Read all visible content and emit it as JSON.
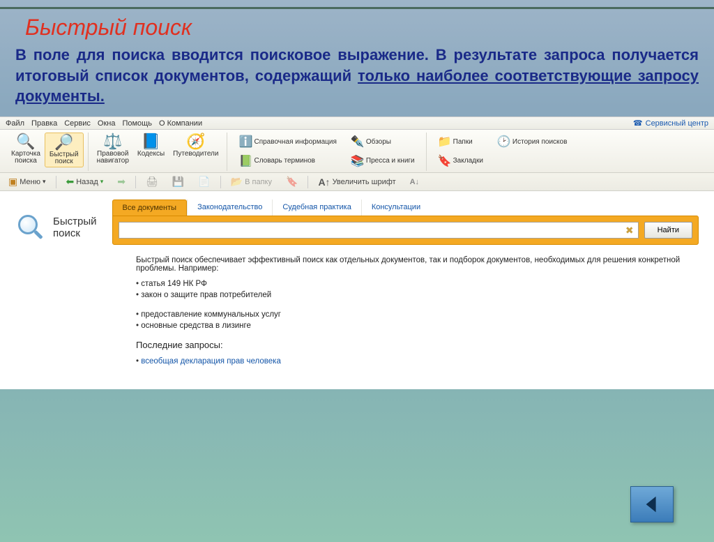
{
  "slide": {
    "title": "Быстрый поиск",
    "text_plain": "В поле для поиска вводится поисковое выражение. В результате запроса получается итоговый список документов, содержащий ",
    "text_underlined": "только наиболее соответствующие запросу документы."
  },
  "menubar": {
    "items": [
      "Файл",
      "Правка",
      "Сервис",
      "Окна",
      "Помощь",
      "О Компании"
    ],
    "service_center": "Сервисный центр"
  },
  "toolbar_main": {
    "kartochka": "Карточка\nпоиска",
    "bystryj": "Быстрый\nпоиск",
    "pravovoj": "Правовой\nнавигатор",
    "kodeksy": "Кодексы",
    "putevoditeli": "Путеводители",
    "sprav": "Справочная информация",
    "obzory": "Обзоры",
    "slovar": "Словарь терминов",
    "pressa": "Пресса и книги",
    "papki": "Папки",
    "istoriya": "История поисков",
    "zakladki": "Закладки"
  },
  "toolbar2": {
    "menu": "Меню",
    "nazad": "Назад",
    "vpapku": "В папку",
    "uvelichit": "Увеличить шрифт"
  },
  "search": {
    "logo_label1": "Быстрый",
    "logo_label2": "поиск",
    "tabs": [
      "Все документы",
      "Законодательство",
      "Судебная практика",
      "Консультации"
    ],
    "placeholder": "",
    "find": "Найти"
  },
  "description": {
    "intro": "Быстрый поиск обеспечивает эффективный поиск как отдельных документов, так и подборок документов, необходимых для решения конкретной проблемы. Например:",
    "examples": [
      "статья 149 НК РФ",
      "закон о защите прав потребителей",
      "предоставление коммунальных услуг",
      "основные средства в лизинге"
    ],
    "recent_header": "Последние запросы:",
    "recent": [
      "всеобщая декларация прав человека"
    ]
  }
}
